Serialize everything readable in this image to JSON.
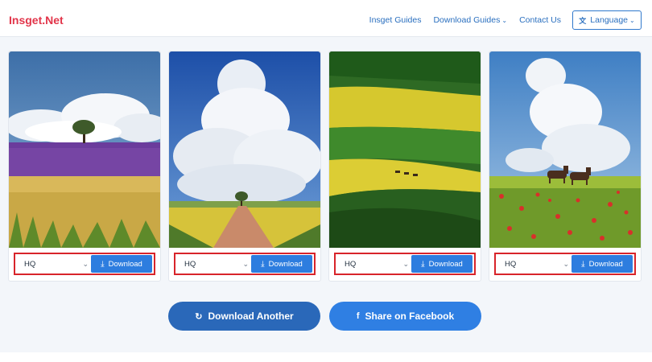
{
  "header": {
    "logo": "Insget.Net",
    "nav": [
      {
        "label": "Insget Guides",
        "dropdown": false
      },
      {
        "label": "Download Guides",
        "dropdown": true
      },
      {
        "label": "Contact Us",
        "dropdown": false
      }
    ],
    "language_label": "Language"
  },
  "cards": [
    {
      "quality": "HQ",
      "download_label": "Download",
      "image": "lavender field with tree under clouds"
    },
    {
      "quality": "HQ",
      "download_label": "Download",
      "image": "dirt road through canola fields with towering cloud"
    },
    {
      "quality": "HQ",
      "download_label": "Download",
      "image": "green and yellow striped hills with animals"
    },
    {
      "quality": "HQ",
      "download_label": "Download",
      "image": "horses in poppy meadow under cumulus cloud"
    }
  ],
  "actions": {
    "download_another": "Download Another",
    "share_facebook": "Share on Facebook"
  },
  "colors": {
    "brand": "#e2354a",
    "link": "#2a6fbf",
    "primary_button": "#2d7ddf",
    "highlight_border": "#d8242a"
  }
}
